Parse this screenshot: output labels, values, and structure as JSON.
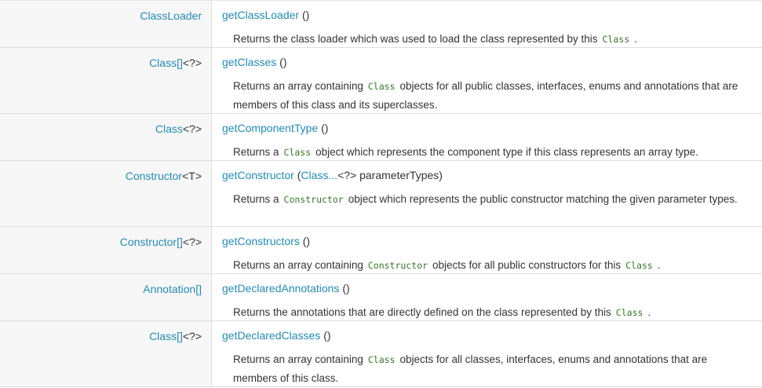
{
  "rows": [
    {
      "type": {
        "link": "ClassLoader",
        "suffix": ""
      },
      "method": "getClassLoader",
      "params": "()",
      "desc": [
        {
          "t": "Returns the class loader which was used to load the class represented by this"
        },
        {
          "c": "Class"
        },
        {
          "t": "."
        }
      ]
    },
    {
      "type": {
        "link": "Class[]",
        "suffix": "<?>"
      },
      "method": "getClasses",
      "params": "()",
      "desc": [
        {
          "t": "Returns an array containing"
        },
        {
          "c": "Class"
        },
        {
          "t": "objects for all public classes, interfaces, enums and annotations that are members of this class and its superclasses."
        }
      ]
    },
    {
      "type": {
        "link": "Class",
        "suffix": "<?>"
      },
      "method": "getComponentType",
      "params": "()",
      "desc": [
        {
          "t": "Returns a"
        },
        {
          "c": "Class"
        },
        {
          "t": "object which represents the component type if this class represents an array type."
        }
      ]
    },
    {
      "type": {
        "link": "Constructor",
        "suffix": "<T>"
      },
      "method": "getConstructor",
      "params_parts": {
        "open": "(",
        "link": "Class...",
        "tail": "<?> parameterTypes)"
      },
      "desc": [
        {
          "t": "Returns a"
        },
        {
          "c": "Constructor"
        },
        {
          "t": "object which represents the public constructor matching the given parameter types."
        }
      ]
    },
    {
      "type": {
        "link": "Constructor[]",
        "suffix": "<?>"
      },
      "method": "getConstructors",
      "params": "()",
      "desc": [
        {
          "t": "Returns an array containing"
        },
        {
          "c": "Constructor"
        },
        {
          "t": "objects for all public constructors for this"
        },
        {
          "c": "Class"
        },
        {
          "t": "."
        }
      ]
    },
    {
      "type": {
        "link": "Annotation[]",
        "suffix": ""
      },
      "method": "getDeclaredAnnotations",
      "params": "()",
      "desc": [
        {
          "t": "Returns the annotations that are directly defined on the class represented by this"
        },
        {
          "c": "Class"
        },
        {
          "t": "."
        }
      ]
    },
    {
      "type": {
        "link": "Class[]",
        "suffix": "<?>"
      },
      "method": "getDeclaredClasses",
      "params": "()",
      "desc": [
        {
          "t": "Returns an array containing"
        },
        {
          "c": "Class"
        },
        {
          "t": "objects for all classes, interfaces, enums and annotations that are members of this class."
        }
      ]
    }
  ]
}
